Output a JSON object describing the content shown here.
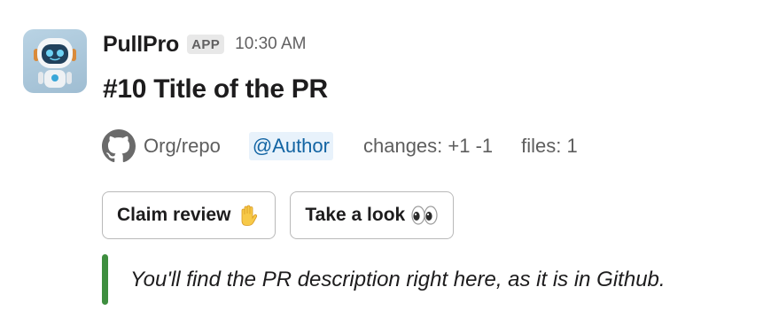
{
  "message": {
    "sender": "PullPro",
    "badge": "APP",
    "timestamp": "10:30 AM",
    "avatar_icon": "robot-avatar-icon"
  },
  "pr": {
    "title": "#10 Title of the PR",
    "repo": "Org/repo",
    "author_mention": "@Author",
    "changes": "changes: +1 -1",
    "files": "files: 1",
    "repo_icon": "github-icon"
  },
  "actions": [
    {
      "label": "Claim review",
      "emoji": "raised-hand-icon"
    },
    {
      "label": "Take a look",
      "emoji": "eyes-icon"
    }
  ],
  "description": {
    "text": "You'll find the PR description right here, as it is in Github.",
    "accent_color": "#3e8e3f"
  },
  "colors": {
    "mention_text": "#1264a3",
    "mention_bg": "#e8f2fb",
    "muted_text": "#616061"
  }
}
